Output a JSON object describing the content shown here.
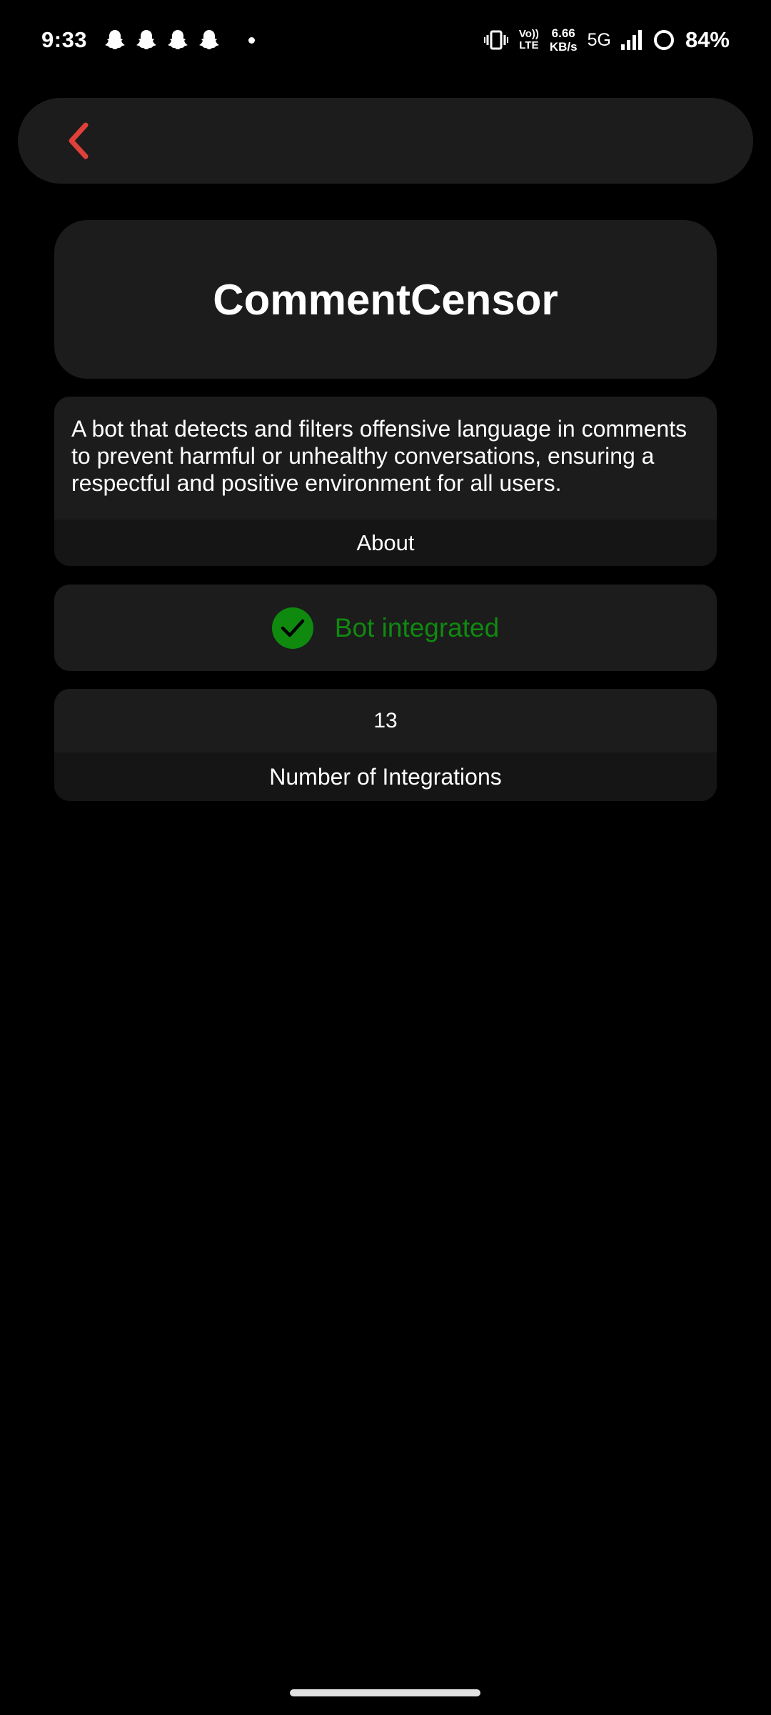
{
  "status_bar": {
    "time": "9:33",
    "notification_icons": [
      "snapchat-icon",
      "snapchat-icon",
      "snapchat-icon",
      "snapchat-icon"
    ],
    "volte": "Vo)) LTE",
    "net_speed_value": "6.66",
    "net_speed_unit": "KB/s",
    "network": "5G",
    "battery": "84%"
  },
  "header": {
    "back_icon": "chevron-left-icon",
    "accent_color": "#e0403a"
  },
  "bot": {
    "name": "CommentCensor",
    "description": "A bot that detects and filters offensive language in comments to prevent harmful or unhealthy conversations, ensuring a respectful and positive environment for all users.",
    "about_label": "About",
    "status_text": "Bot integrated",
    "status_icon": "check-circle-icon",
    "status_color": "#0f8a0f",
    "integrations_count": "13",
    "integrations_label": "Number of Integrations"
  }
}
